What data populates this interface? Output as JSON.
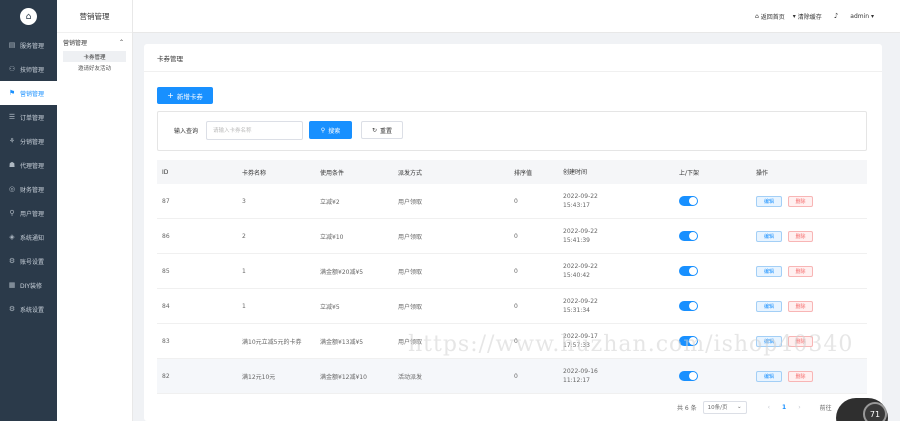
{
  "sidebar": {
    "logo_icon": "home-icon",
    "items": [
      {
        "label": "服务管理",
        "icon": "▤"
      },
      {
        "label": "技师管理",
        "icon": "⚇"
      },
      {
        "label": "营销管理",
        "icon": "⚑",
        "active": true
      },
      {
        "label": "订单管理",
        "icon": "☰"
      },
      {
        "label": "分销管理",
        "icon": "⚘"
      },
      {
        "label": "代理管理",
        "icon": "☗"
      },
      {
        "label": "财务管理",
        "icon": "◎"
      },
      {
        "label": "用户管理",
        "icon": "⚲"
      },
      {
        "label": "系统通知",
        "icon": "◈"
      },
      {
        "label": "账号设置",
        "icon": "⚙"
      },
      {
        "label": "DIY装修",
        "icon": "▦"
      },
      {
        "label": "系统设置",
        "icon": "⚙"
      }
    ]
  },
  "subbar": {
    "title": "营销管理",
    "group": "营销管理",
    "items": [
      "卡券管理",
      "邀请好友活动"
    ]
  },
  "topbar": {
    "back_home": "返回首页",
    "clear_cache": "清除缓存",
    "user": "admin ▾"
  },
  "page": {
    "title": "卡券管理",
    "add_button": "新增卡券",
    "search_label": "输入查询",
    "search_placeholder": "请输入卡券名称",
    "search_button": "搜索",
    "reset_button": "重置"
  },
  "table": {
    "headers": [
      "ID",
      "卡券名称",
      "使用条件",
      "派发方式",
      "排序值",
      "创建时间",
      "上/下架",
      "操作"
    ],
    "edit_label": "编辑",
    "delete_label": "删除",
    "rows": [
      {
        "id": "87",
        "name": "3",
        "cond": "立减¥2",
        "method": "用户领取",
        "sort": "0",
        "date": "2022-09-22",
        "time": "15:43:17",
        "on": true
      },
      {
        "id": "86",
        "name": "2",
        "cond": "立减¥10",
        "method": "用户领取",
        "sort": "0",
        "date": "2022-09-22",
        "time": "15:41:39",
        "on": true
      },
      {
        "id": "85",
        "name": "1",
        "cond": "满金额¥20减¥5",
        "method": "用户领取",
        "sort": "0",
        "date": "2022-09-22",
        "time": "15:40:42",
        "on": true
      },
      {
        "id": "84",
        "name": "1",
        "cond": "立减¥5",
        "method": "用户领取",
        "sort": "0",
        "date": "2022-09-22",
        "time": "15:31:34",
        "on": true
      },
      {
        "id": "83",
        "name": "满10元立减5元的卡券",
        "cond": "满金额¥13减¥5",
        "method": "用户领取",
        "sort": "0",
        "date": "2022-09-17",
        "time": "17:57:33",
        "on": true
      },
      {
        "id": "82",
        "name": "满12元10元",
        "cond": "满金额¥12减¥10",
        "method": "活动派发",
        "sort": "0",
        "date": "2022-09-16",
        "time": "11:12:17",
        "on": true,
        "highlight": true
      }
    ]
  },
  "pagination": {
    "total": "共 6 条",
    "page_size": "10条/页",
    "current": "1",
    "prev": "‹",
    "next": "›",
    "goto": "前往"
  },
  "watermark": "https://www.huzhan.com/ishop40340",
  "float_badge": "71",
  "colors": {
    "primary": "#1890ff",
    "sidebar": "#2b3a4a",
    "danger": "#f56c6c"
  }
}
